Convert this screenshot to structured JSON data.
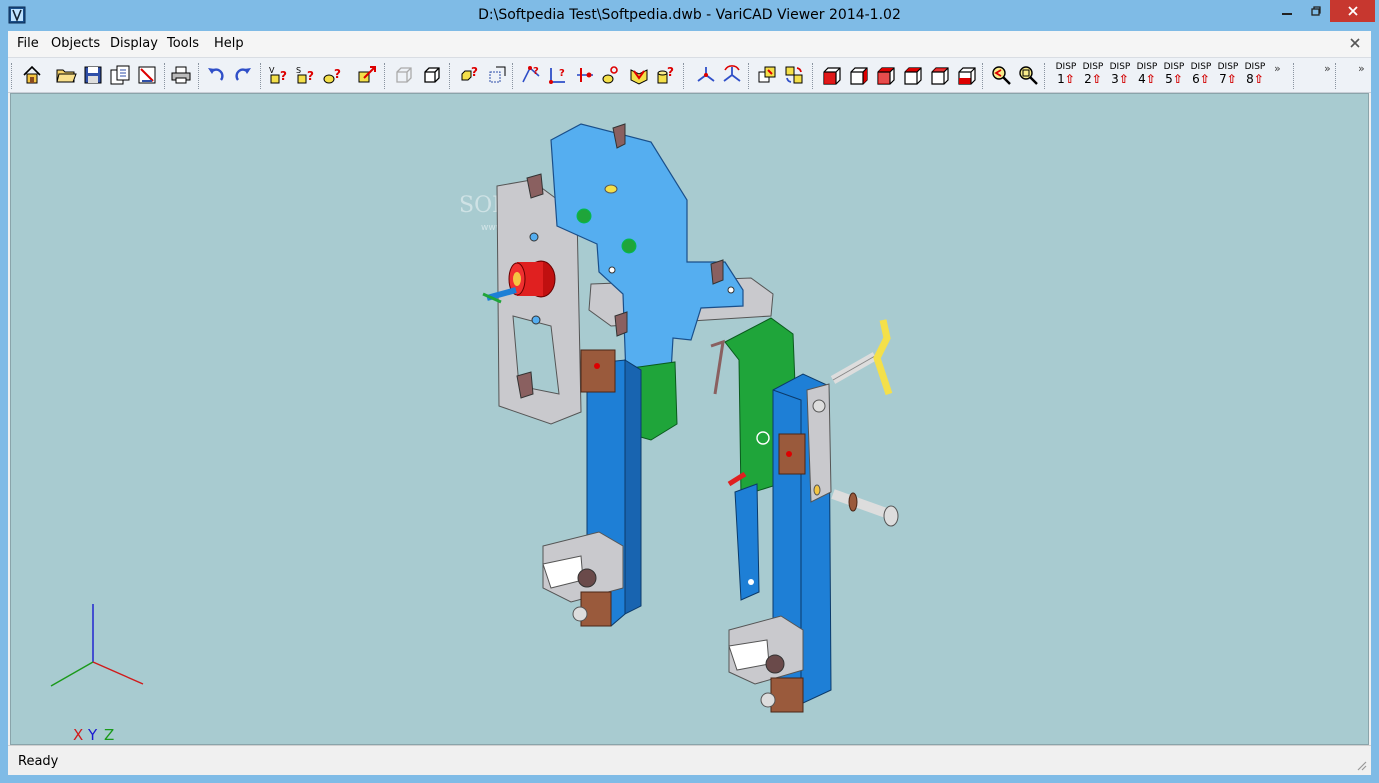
{
  "window": {
    "title": "D:\\Softpedia Test\\Softpedia.dwb - VariCAD Viewer 2014-1.02"
  },
  "menu": {
    "items": [
      "File",
      "Objects",
      "Display",
      "Tools",
      "Help"
    ]
  },
  "toolbar": {
    "disp_label": "DISP",
    "disp_numbers": [
      "1",
      "2",
      "3",
      "4",
      "5",
      "6",
      "7",
      "8"
    ],
    "more_glyph": "»"
  },
  "viewport": {
    "axis_x": "X",
    "axis_y": "Y",
    "axis_z": "Z",
    "watermark": "SOFTPEDIA",
    "watermark_sub": "www.softpedia.com"
  },
  "status": {
    "text": "Ready"
  },
  "colors": {
    "title_bg": "#7fbbe6",
    "viewport_bg": "#a8cbd0",
    "close_red": "#c7372f",
    "part_blue": "#1e7fd6",
    "plate_blue": "#55aef0",
    "part_green": "#1fa53a",
    "part_gray": "#c8c8cc",
    "part_brown": "#9a5a3c"
  }
}
